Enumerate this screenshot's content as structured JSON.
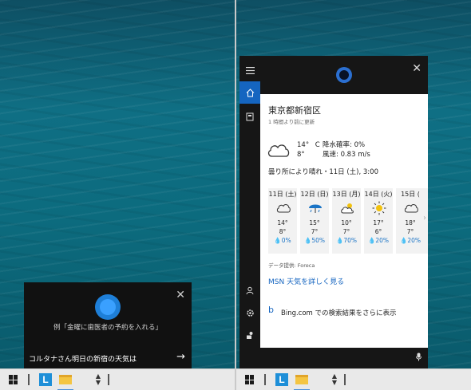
{
  "left": {
    "cortana_hint": "例「金曜に歯医者の予約を入れる」",
    "query_text": "コルタナさん明日の新宿の天気は",
    "close_symbol": "✕",
    "send_arrow": "→"
  },
  "right": {
    "close_symbol": "✕",
    "location": "東京都新宿区",
    "updated": "1 時間より前に更新",
    "current": {
      "temp": "14°",
      "unit": "C",
      "low": "8°",
      "precip": "降水確率: 0%",
      "wind": "風速: 0.83 m/s"
    },
    "summary": "曇り所により晴れ・11日 (土), 3:00",
    "forecast": [
      {
        "day": "11日 (土)",
        "hi": "14°",
        "lo": "8°",
        "precip": "💧0%",
        "icon": "cloud-icon"
      },
      {
        "day": "12日 (日)",
        "hi": "15°",
        "lo": "7°",
        "precip": "💧50%",
        "icon": "umbrella-rain-icon"
      },
      {
        "day": "13日 (月)",
        "hi": "10°",
        "lo": "7°",
        "precip": "💧70%",
        "icon": "sun-cloud-icon"
      },
      {
        "day": "14日 (火)",
        "hi": "17°",
        "lo": "6°",
        "precip": "💧20%",
        "icon": "sun-icon"
      },
      {
        "day": "15日 (",
        "hi": "18°",
        "lo": "7°",
        "precip": "💧20%",
        "icon": "cloud-icon"
      }
    ],
    "provider": "データ提供: Foreca",
    "msn_link": "MSN 天気を詳しく見る",
    "bing_text": "Bing.com での検索結果をさらに表示"
  },
  "colors": {
    "accent": "#1565c0",
    "panel_dark": "#161616",
    "taskbar": "#e9e9e9"
  }
}
